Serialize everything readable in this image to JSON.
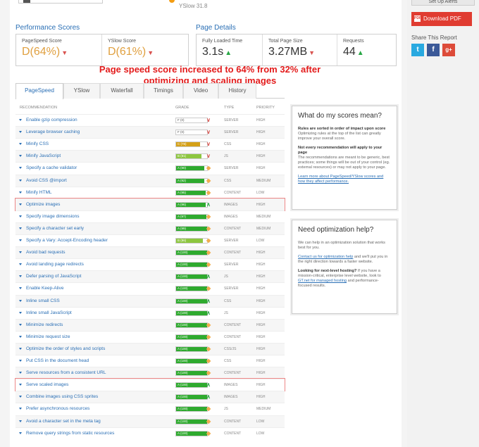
{
  "top": {
    "yslow_score_text": "YSlow 31.8"
  },
  "performance": {
    "title": "Performance Scores",
    "pagespeed": {
      "label": "PageSpeed Score",
      "value": "D(64%)"
    },
    "yslow": {
      "label": "YSlow Score",
      "value": "D(61%)"
    }
  },
  "details": {
    "title": "Page Details",
    "load_time": {
      "label": "Fully Loaded Time",
      "value": "3.1s"
    },
    "page_size": {
      "label": "Total Page Size",
      "value": "3.27MB"
    },
    "requests": {
      "label": "Requests",
      "value": "44"
    }
  },
  "annotation": "Page speed score increased to 64% from 32% after optimizing and scaling images",
  "tabs": [
    "PageSpeed",
    "YSlow",
    "Waterfall",
    "Timings",
    "Video",
    "History"
  ],
  "table": {
    "headers": {
      "recommendation": "RECOMMENDATION",
      "grade": "GRADE",
      "type": "TYPE",
      "priority": "PRIORITY"
    },
    "rows": [
      {
        "name": "Enable gzip compression",
        "grade": "F (0)",
        "pct": 0,
        "color": "#ffffff",
        "ind": "down",
        "type": "SERVER",
        "priority": "HIGH"
      },
      {
        "name": "Leverage browser caching",
        "grade": "F (0)",
        "pct": 0,
        "color": "#ffffff",
        "ind": "down",
        "type": "SERVER",
        "priority": "HIGH"
      },
      {
        "name": "Minify CSS",
        "grade": "C (78)",
        "pct": 78,
        "color": "#d4a017",
        "ind": "down",
        "type": "CSS",
        "priority": "HIGH"
      },
      {
        "name": "Minify JavaScript",
        "grade": "B (81)",
        "pct": 81,
        "color": "#8dc63f",
        "ind": "down",
        "type": "JS",
        "priority": "HIGH"
      },
      {
        "name": "Specify a cache validator",
        "grade": "A (90)",
        "pct": 90,
        "color": "#2eaa2e",
        "ind": "diamond",
        "type": "SERVER",
        "priority": "HIGH"
      },
      {
        "name": "Avoid CSS @import",
        "grade": "A (92)",
        "pct": 92,
        "color": "#2eaa2e",
        "ind": "diamond",
        "type": "CSS",
        "priority": "MEDIUM"
      },
      {
        "name": "Minify HTML",
        "grade": "A (95)",
        "pct": 95,
        "color": "#2eaa2e",
        "ind": "diamond",
        "type": "CONTENT",
        "priority": "LOW"
      },
      {
        "name": "Optimize images",
        "grade": "A (96)",
        "pct": 96,
        "color": "#2eaa2e",
        "ind": "up",
        "type": "IMAGES",
        "priority": "HIGH",
        "highlight": true
      },
      {
        "name": "Specify image dimensions",
        "grade": "A (97)",
        "pct": 97,
        "color": "#2eaa2e",
        "ind": "diamond",
        "type": "IMAGES",
        "priority": "MEDIUM"
      },
      {
        "name": "Specify a character set early",
        "grade": "A (99)",
        "pct": 99,
        "color": "#2eaa2e",
        "ind": "diamond",
        "type": "CONTENT",
        "priority": "MEDIUM"
      },
      {
        "name": "Specify a Vary: Accept-Encoding header",
        "grade": "B (86)",
        "pct": 86,
        "color": "#8dc63f",
        "ind": "diamond",
        "type": "SERVER",
        "priority": "LOW"
      },
      {
        "name": "Avoid bad requests",
        "grade": "A (100)",
        "pct": 100,
        "color": "#2eaa2e",
        "ind": "diamond",
        "type": "CONTENT",
        "priority": "HIGH"
      },
      {
        "name": "Avoid landing page redirects",
        "grade": "A (100)",
        "pct": 100,
        "color": "#2eaa2e",
        "ind": "diamond",
        "type": "SERVER",
        "priority": "HIGH"
      },
      {
        "name": "Defer parsing of JavaScript",
        "grade": "A (100)",
        "pct": 100,
        "color": "#2eaa2e",
        "ind": "up",
        "type": "JS",
        "priority": "HIGH"
      },
      {
        "name": "Enable Keep-Alive",
        "grade": "A (100)",
        "pct": 100,
        "color": "#2eaa2e",
        "ind": "diamond",
        "type": "SERVER",
        "priority": "HIGH"
      },
      {
        "name": "Inline small CSS",
        "grade": "A (100)",
        "pct": 100,
        "color": "#2eaa2e",
        "ind": "up",
        "type": "CSS",
        "priority": "HIGH"
      },
      {
        "name": "Inline small JavaScript",
        "grade": "A (100)",
        "pct": 100,
        "color": "#2eaa2e",
        "ind": "up",
        "type": "JS",
        "priority": "HIGH"
      },
      {
        "name": "Minimize redirects",
        "grade": "A (100)",
        "pct": 100,
        "color": "#2eaa2e",
        "ind": "diamond",
        "type": "CONTENT",
        "priority": "HIGH"
      },
      {
        "name": "Minimize request size",
        "grade": "A (100)",
        "pct": 100,
        "color": "#2eaa2e",
        "ind": "diamond",
        "type": "CONTENT",
        "priority": "HIGH"
      },
      {
        "name": "Optimize the order of styles and scripts",
        "grade": "A (100)",
        "pct": 100,
        "color": "#2eaa2e",
        "ind": "diamond",
        "type": "CSS/JS",
        "priority": "HIGH"
      },
      {
        "name": "Put CSS in the document head",
        "grade": "A (100)",
        "pct": 100,
        "color": "#2eaa2e",
        "ind": "diamond",
        "type": "CSS",
        "priority": "HIGH"
      },
      {
        "name": "Serve resources from a consistent URL",
        "grade": "A (100)",
        "pct": 100,
        "color": "#2eaa2e",
        "ind": "diamond",
        "type": "CONTENT",
        "priority": "HIGH"
      },
      {
        "name": "Serve scaled images",
        "grade": "A (100)",
        "pct": 100,
        "color": "#2eaa2e",
        "ind": "up",
        "type": "IMAGES",
        "priority": "HIGH",
        "highlight": true
      },
      {
        "name": "Combine images using CSS sprites",
        "grade": "A (100)",
        "pct": 100,
        "color": "#2eaa2e",
        "ind": "up",
        "type": "IMAGES",
        "priority": "HIGH"
      },
      {
        "name": "Prefer asynchronous resources",
        "grade": "A (100)",
        "pct": 100,
        "color": "#2eaa2e",
        "ind": "diamond",
        "type": "JS",
        "priority": "MEDIUM"
      },
      {
        "name": "Avoid a character set in the meta tag",
        "grade": "A (100)",
        "pct": 100,
        "color": "#2eaa2e",
        "ind": "diamond",
        "type": "CONTENT",
        "priority": "LOW"
      },
      {
        "name": "Remove query strings from static resources",
        "grade": "A (100)",
        "pct": 100,
        "color": "#2eaa2e",
        "ind": "diamond",
        "type": "CONTENT",
        "priority": "LOW"
      }
    ]
  },
  "box1": {
    "title": "What do my scores mean?",
    "p1_bold": "Rules are sorted in order of impact upon score",
    "p1": "Optimizing rules at the top of the list can greatly improve your overall score.",
    "p2_bold": "Not every recommendation will apply to your page",
    "p2": "The recommendations are meant to be generic, best practices; some things will be out of your control (eg. external resources) or may not apply to your page.",
    "link": "Learn more about PageSpeed/YSlow scores and how they affect performance."
  },
  "box2": {
    "title": "Need optimization help?",
    "p1": "We can help in an optimization solution that works best for you.",
    "link1": "Contact us for optimization help",
    "p2": "and we'll put you in the right direction towards a faster website.",
    "bold": "Looking for next-level hosting?",
    "p3": "If you have a mission-critical, enterprise level website, look to",
    "link2": "GT.net for managed hosting",
    "p4": "and performance-focused results."
  },
  "sidebar": {
    "alerts_label": "Set Up Alerts",
    "pdf_label": "Download PDF",
    "share_label": "Share This Report"
  },
  "colors": {
    "accent": "#2a6fb5",
    "annotation": "#e31b1b",
    "pdf": "#e03c31"
  }
}
